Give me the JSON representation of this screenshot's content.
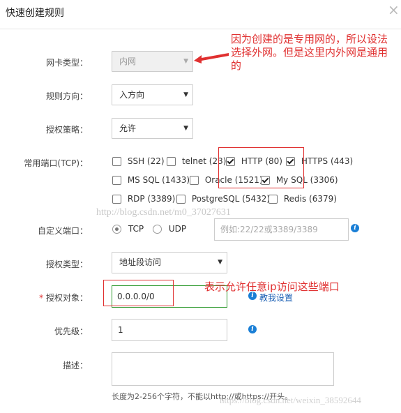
{
  "dialog": {
    "title": "快速创建规则",
    "close_symbol": "×"
  },
  "form": {
    "nic_type": {
      "label": "网卡类型：",
      "value": "内网",
      "disabled": true
    },
    "direction": {
      "label": "规则方向：",
      "value": "入方向"
    },
    "policy": {
      "label": "授权策略：",
      "value": "允许"
    },
    "common_ports": {
      "label": "常用端口(TCP)：",
      "options": [
        {
          "label": "SSH (22)",
          "checked": false
        },
        {
          "label": "telnet (23)",
          "checked": false
        },
        {
          "label": "HTTP (80)",
          "checked": true
        },
        {
          "label": "HTTPS (443)",
          "checked": true
        },
        {
          "label": "MS SQL (1433)",
          "checked": false
        },
        {
          "label": "Oracle (1521)",
          "checked": false
        },
        {
          "label": "My SQL (3306)",
          "checked": true
        },
        {
          "label": "RDP (3389)",
          "checked": false
        },
        {
          "label": "PostgreSQL (5432)",
          "checked": false
        },
        {
          "label": "Redis (6379)",
          "checked": false
        }
      ]
    },
    "custom_port": {
      "label": "自定义端口：",
      "protocols": [
        {
          "label": "TCP",
          "selected": true
        },
        {
          "label": "UDP",
          "selected": false
        }
      ],
      "placeholder": "例如:22/22或3389/3389"
    },
    "auth_type": {
      "label": "授权类型：",
      "value": "地址段访问"
    },
    "auth_object": {
      "required_mark": "*",
      "label": "授权对象：",
      "value": "0.0.0.0/0",
      "help_link": "教我设置"
    },
    "priority": {
      "label": "优先级：",
      "value": "1"
    },
    "description": {
      "label": "描述：",
      "hint": "长度为2-256个字符，不能以http://或https://开头。"
    }
  },
  "annotations": {
    "top_note": [
      "因为创建的是专用网的，所以设法",
      "选择外网。但是这里内外网是通用",
      "的"
    ],
    "auth_note": "表示允许任意ip访问这些端口"
  },
  "watermarks": {
    "middle": "http://blog.csdn.net/m0_37027631",
    "bottom": "https://blog.csdn.net/weixin_38592644"
  },
  "icons": {
    "info": "info-icon",
    "dropdown": "caret-down-icon",
    "close": "close-icon",
    "arrow": "red-arrow-icon"
  },
  "colors": {
    "annotation_red": "#e03030",
    "highlight_green": "#2e9a2e",
    "link_blue": "#1a5fb4",
    "info_blue": "#1a7fd6"
  }
}
